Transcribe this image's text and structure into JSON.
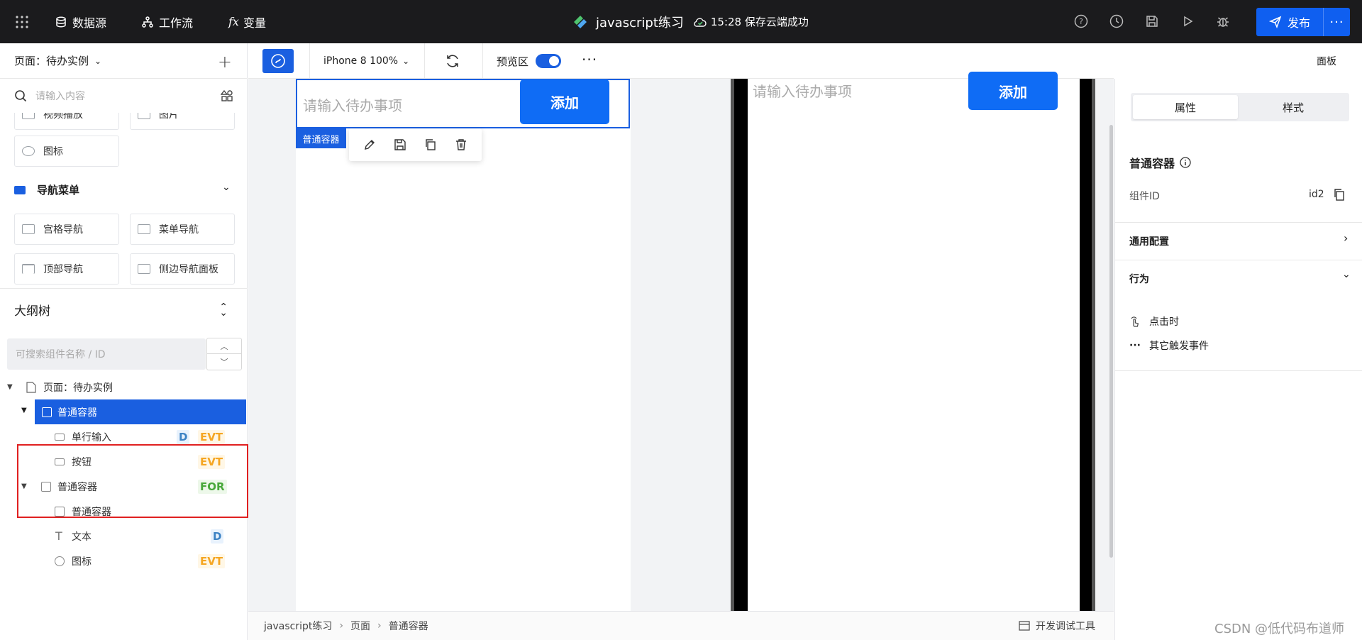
{
  "topbar": {
    "datasource": "数据源",
    "workflow": "工作流",
    "variables": "变量",
    "project_title": "javascript练习",
    "save_status": "15:28 保存云端成功",
    "publish": "发布"
  },
  "left_panel": {
    "page_selector": "页面：待办实例",
    "search_placeholder": "请输入内容",
    "components_partial": [
      "视频播放",
      "图片"
    ],
    "icon_item": "图标",
    "nav_section": "导航菜单",
    "nav_items": [
      "宫格导航",
      "菜单导航",
      "顶部导航",
      "侧边导航面板"
    ]
  },
  "outline": {
    "title": "大纲树",
    "search_placeholder": "可搜索组件名称 / ID",
    "root": "页面：待办实例",
    "nodes": [
      {
        "label": "普通容器",
        "badge": ""
      },
      {
        "label": "单行输入",
        "badge": "D",
        "badge2": "EVT"
      },
      {
        "label": "按钮",
        "badge": "EVT"
      },
      {
        "label": "普通容器",
        "badge": "FOR"
      },
      {
        "label": "普通容器",
        "badge": ""
      },
      {
        "label": "文本",
        "badge": "D"
      },
      {
        "label": "图标",
        "badge": "EVT"
      }
    ]
  },
  "toolbar": {
    "device": "iPhone 8 100%",
    "preview_label": "预览区",
    "panel_label": "面板"
  },
  "canvas": {
    "input_placeholder": "请输入待办事项",
    "add_button": "添加",
    "selected_tag": "普通容器",
    "preview_input_placeholder": "请输入待办事项",
    "preview_add_button": "添加"
  },
  "right_panel": {
    "tab_props": "属性",
    "tab_style": "样式",
    "component_title": "普通容器",
    "id_label": "组件ID",
    "id_value": "id2",
    "general_config": "通用配置",
    "behavior": "行为",
    "on_click": "点击时",
    "other_events": "其它触发事件"
  },
  "footer": {
    "breadcrumb": [
      "javascript练习",
      "页面",
      "普通容器"
    ],
    "dev_tools": "开发调试工具"
  },
  "watermark": "CSDN @低代码布道师",
  "colors": {
    "accent": "#1a5fe0",
    "topbar": "#1b1b1d",
    "evt": "#f5a623",
    "for": "#48a83a"
  }
}
